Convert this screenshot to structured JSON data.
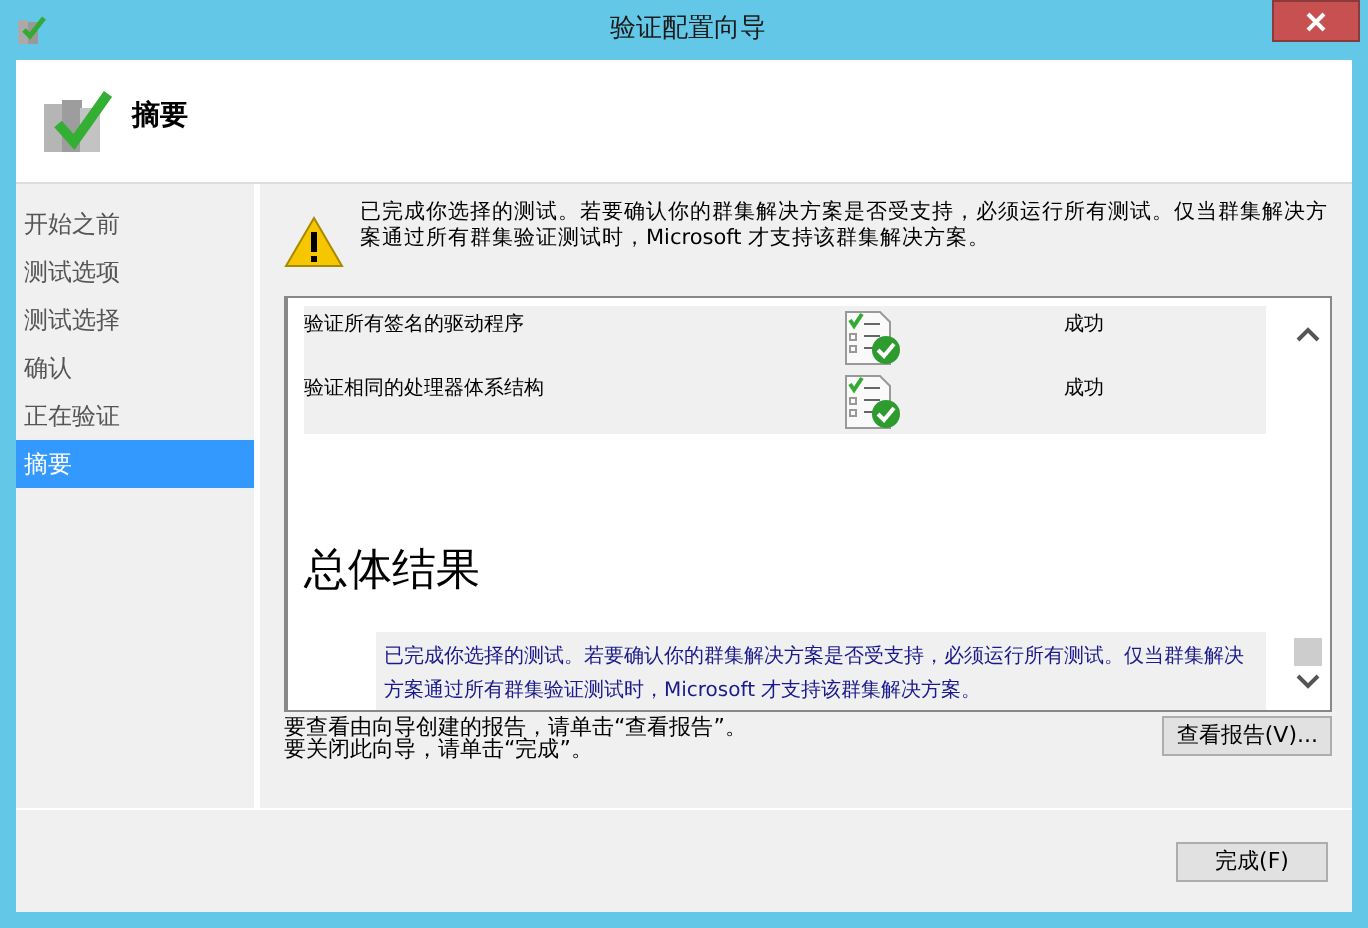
{
  "window": {
    "title": "验证配置向导"
  },
  "header": {
    "title": "摘要"
  },
  "sidebar": {
    "items": [
      {
        "label": "开始之前",
        "selected": false
      },
      {
        "label": "测试选项",
        "selected": false
      },
      {
        "label": "测试选择",
        "selected": false
      },
      {
        "label": "确认",
        "selected": false
      },
      {
        "label": "正在验证",
        "selected": false
      },
      {
        "label": "摘要",
        "selected": true
      }
    ]
  },
  "warning": "已完成你选择的测试。若要确认你的群集解决方案是否受支持，必须运行所有测试。仅当群集解决方案通过所有群集验证测试时，Microsoft 才支持该群集解决方案。",
  "report": {
    "rows": [
      {
        "test": "验证所有签名的驱动程序",
        "result": "成功"
      },
      {
        "test": "验证相同的处理器体系结构",
        "result": "成功"
      }
    ],
    "heading": "总体结果",
    "summary": "已完成你选择的测试。若要确认你的群集解决方案是否受支持，必须运行所有测试。仅当群集解决方案通过所有群集验证测试时，Microsoft 才支持该群集解决方案。"
  },
  "notes": [
    "要查看由向导创建的报告，请单击“查看报告”。",
    "要关闭此向导，请单击“完成”。"
  ],
  "buttons": {
    "view_report": "查看报告(V)...",
    "finish": "完成(F)"
  }
}
